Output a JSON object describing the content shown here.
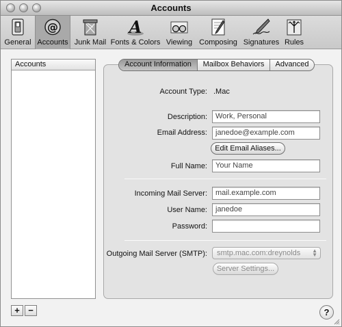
{
  "window": {
    "title": "Accounts"
  },
  "toolbar": {
    "items": [
      {
        "label": "General",
        "icon": "switch-icon"
      },
      {
        "label": "Accounts",
        "icon": "at-sign-icon"
      },
      {
        "label": "Junk Mail",
        "icon": "trash-can-icon"
      },
      {
        "label": "Fonts & Colors",
        "icon": "font-a-icon"
      },
      {
        "label": "Viewing",
        "icon": "glasses-icon"
      },
      {
        "label": "Composing",
        "icon": "pen-paper-icon"
      },
      {
        "label": "Signatures",
        "icon": "fountain-pen-icon"
      },
      {
        "label": "Rules",
        "icon": "rules-arrows-icon"
      }
    ],
    "selected": "Accounts"
  },
  "accounts_list": {
    "header": "Accounts",
    "add_label": "+",
    "remove_label": "−"
  },
  "tabs": [
    "Account Information",
    "Mailbox Behaviors",
    "Advanced"
  ],
  "active_tab": "Account Information",
  "form": {
    "account_type_label": "Account Type:",
    "account_type_value": ".Mac",
    "description_label": "Description:",
    "description_value": "Work, Personal",
    "email_label": "Email Address:",
    "email_value": "janedoe@example.com",
    "edit_aliases_label": "Edit Email Aliases...",
    "full_name_label": "Full Name:",
    "full_name_value": "Your Name",
    "incoming_label": "Incoming Mail Server:",
    "incoming_value": "mail.example.com",
    "username_label": "User Name:",
    "username_value": "janedoe",
    "password_label": "Password:",
    "password_value": "",
    "smtp_label": "Outgoing Mail Server (SMTP):",
    "smtp_value": "smtp.mac.com:dreynolds",
    "server_settings_label": "Server Settings..."
  },
  "help_label": "?"
}
